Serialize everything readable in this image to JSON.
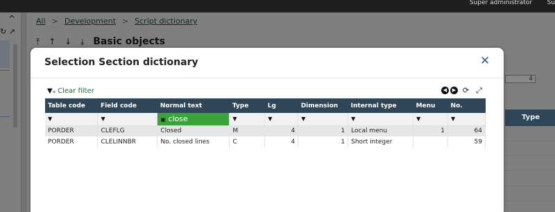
{
  "topbar": {
    "user": "Super administrator",
    "extra": "Su"
  },
  "left": {
    "chevron": "^",
    "tools": "↻ ↗"
  },
  "breadcrumb": {
    "items": [
      "All",
      "Development",
      "Script dictionary"
    ],
    "separator": ">"
  },
  "background": {
    "title": "Basic objects",
    "nav_arrows": [
      "⤒",
      "↑",
      "↓",
      "⤓"
    ],
    "field_value": "4",
    "column_header": "Type"
  },
  "modal": {
    "title": "Selection Section dictionary",
    "close_icon": "close-icon",
    "clear_filter_label": "Clear filter",
    "columns": [
      "Table code",
      "Field code",
      "Normal text",
      "Type",
      "Lg",
      "Dimension",
      "Internal type",
      "Menu",
      "No."
    ],
    "filter_value": "close",
    "rows": [
      [
        "PORDER",
        "CLEFLG",
        "Closed",
        "M",
        "4",
        "1",
        "Local menu",
        "1",
        "64"
      ],
      [
        "PORDER",
        "CLELINNBR",
        "No. closed lines",
        "C",
        "4",
        "1",
        "Short integer",
        "",
        "59"
      ]
    ]
  },
  "colors": {
    "header_bg": "#2e4657",
    "filter_active": "#3aa43a",
    "link": "#1e6b3a"
  }
}
